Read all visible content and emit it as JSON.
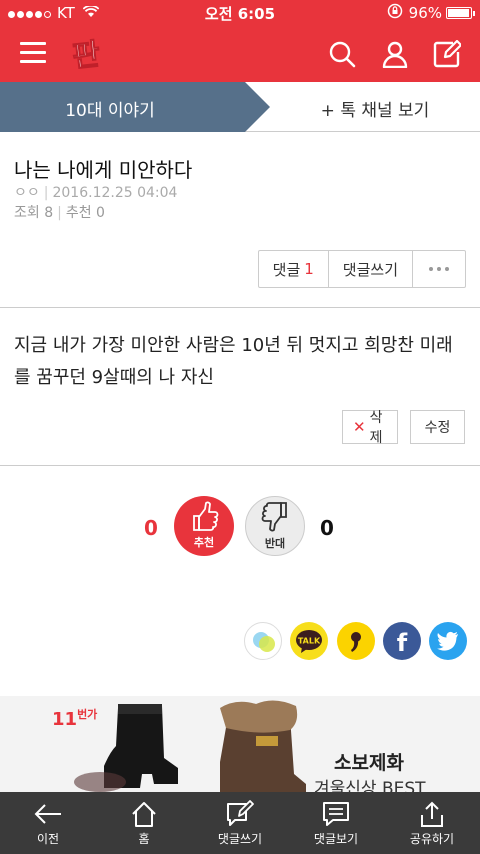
{
  "status_bar": {
    "carrier": "KT",
    "time": "오전 6:05",
    "battery": "96%",
    "battery_level": 0.96
  },
  "header": {
    "logo_text": "판"
  },
  "tabs": {
    "active": "10대 이야기",
    "other": "+ 톡 채널 보기"
  },
  "post": {
    "title": "나는 나에게 미안하다",
    "author": "ㅇㅇ",
    "date": "2016.12.25 04:04",
    "views": "조회 8",
    "likes": "추천 0",
    "comment_label": "댓글",
    "comment_count": "1",
    "write_comment": "댓글쓰기",
    "content": "지금 내가 가장 미안한 사람은 10년 뒤 멋지고 희망찬 미래를 꿈꾸던 9살때의 나 자신",
    "delete_label": "삭제",
    "edit_label": "수정"
  },
  "vote": {
    "up_count": "0",
    "up_label": "추천",
    "down_label": "반대",
    "down_count": "0"
  },
  "share": {
    "kakaotalk_label": "TALK"
  },
  "ad": {
    "brand": "11",
    "brand_suffix": "번가",
    "headline": "소보제화",
    "sub": "겨울신상 BEST"
  },
  "bottom_nav": [
    {
      "label": "이전"
    },
    {
      "label": "홈"
    },
    {
      "label": "댓글쓰기"
    },
    {
      "label": "댓글보기"
    },
    {
      "label": "공유하기"
    }
  ],
  "colors": {
    "brand_red": "#e8343c",
    "tab_slate": "#56708a",
    "bottom_bar": "#3a3a3a"
  }
}
